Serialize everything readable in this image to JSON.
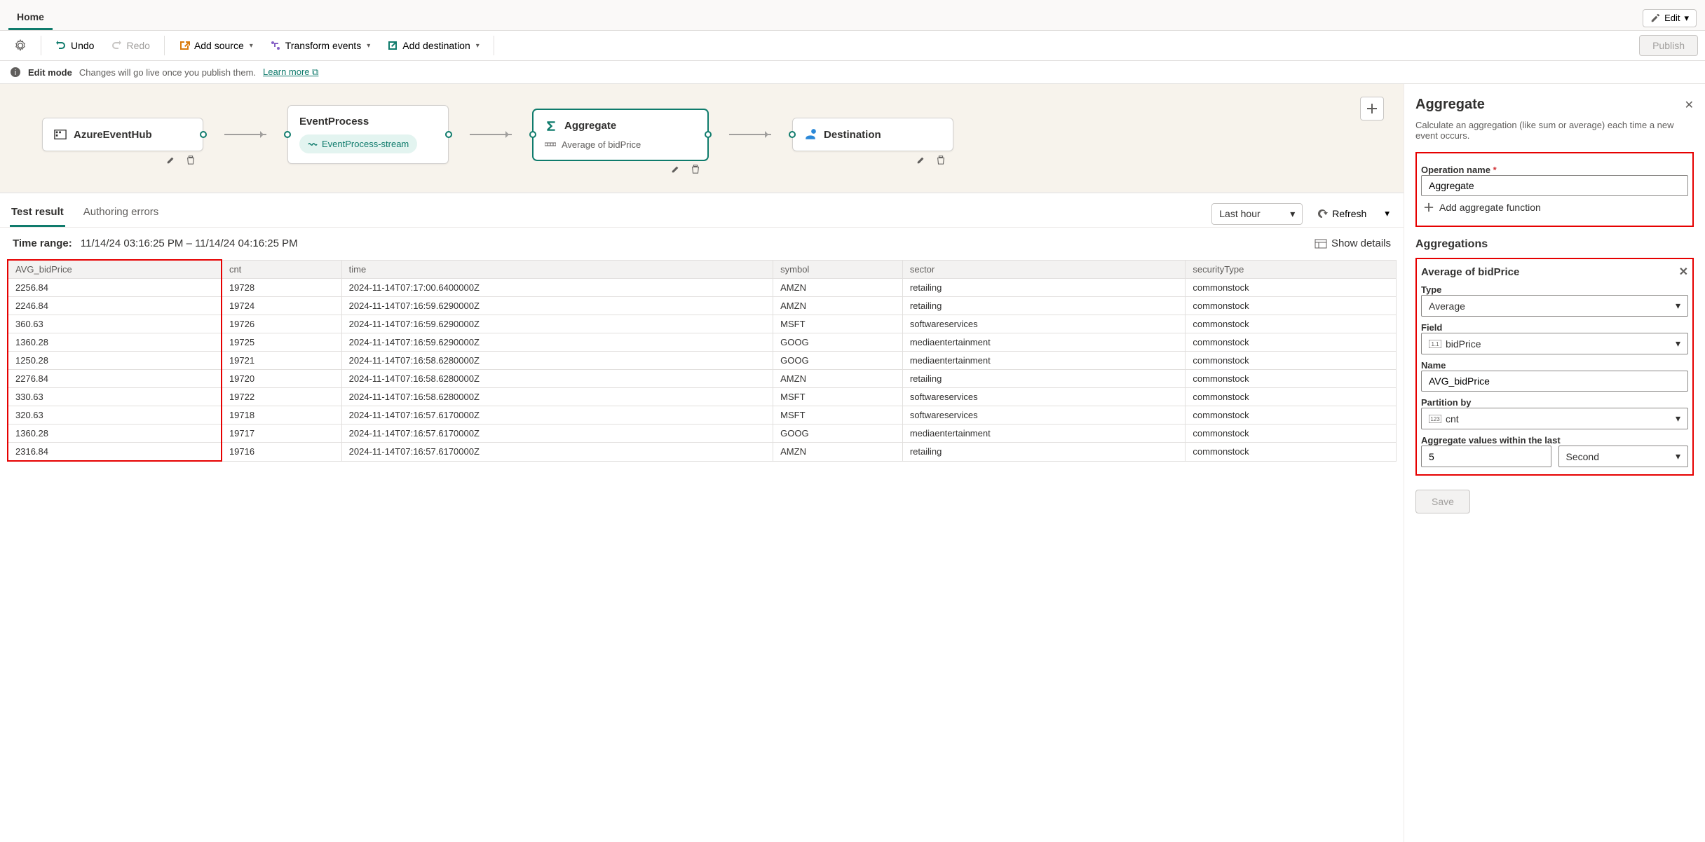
{
  "tabs": {
    "home": "Home",
    "edit": "Edit"
  },
  "toolbar": {
    "undo": "Undo",
    "redo": "Redo",
    "add_source": "Add source",
    "transform": "Transform events",
    "add_dest": "Add destination",
    "publish": "Publish"
  },
  "info": {
    "mode": "Edit mode",
    "msg": "Changes will go live once you publish them.",
    "learn": "Learn more"
  },
  "nodes": {
    "source": {
      "title": "AzureEventHub"
    },
    "process": {
      "title": "EventProcess",
      "stream": "EventProcess-stream"
    },
    "aggregate": {
      "title": "Aggregate",
      "sub": "Average of bidPrice"
    },
    "dest": {
      "title": "Destination"
    }
  },
  "results": {
    "tab_test": "Test result",
    "tab_errors": "Authoring errors",
    "range": "Last hour",
    "refresh": "Refresh",
    "time_label": "Time range:",
    "time_value": "11/14/24 03:16:25 PM – 11/14/24 04:16:25 PM",
    "show_details": "Show details",
    "columns": [
      "AVG_bidPrice",
      "cnt",
      "time",
      "symbol",
      "sector",
      "securityType"
    ],
    "rows": [
      [
        "2256.84",
        "19728",
        "2024-11-14T07:17:00.6400000Z",
        "AMZN",
        "retailing",
        "commonstock"
      ],
      [
        "2246.84",
        "19724",
        "2024-11-14T07:16:59.6290000Z",
        "AMZN",
        "retailing",
        "commonstock"
      ],
      [
        "360.63",
        "19726",
        "2024-11-14T07:16:59.6290000Z",
        "MSFT",
        "softwareservices",
        "commonstock"
      ],
      [
        "1360.28",
        "19725",
        "2024-11-14T07:16:59.6290000Z",
        "GOOG",
        "mediaentertainment",
        "commonstock"
      ],
      [
        "1250.28",
        "19721",
        "2024-11-14T07:16:58.6280000Z",
        "GOOG",
        "mediaentertainment",
        "commonstock"
      ],
      [
        "2276.84",
        "19720",
        "2024-11-14T07:16:58.6280000Z",
        "AMZN",
        "retailing",
        "commonstock"
      ],
      [
        "330.63",
        "19722",
        "2024-11-14T07:16:58.6280000Z",
        "MSFT",
        "softwareservices",
        "commonstock"
      ],
      [
        "320.63",
        "19718",
        "2024-11-14T07:16:57.6170000Z",
        "MSFT",
        "softwareservices",
        "commonstock"
      ],
      [
        "1360.28",
        "19717",
        "2024-11-14T07:16:57.6170000Z",
        "GOOG",
        "mediaentertainment",
        "commonstock"
      ],
      [
        "2316.84",
        "19716",
        "2024-11-14T07:16:57.6170000Z",
        "AMZN",
        "retailing",
        "commonstock"
      ]
    ]
  },
  "panel": {
    "title": "Aggregate",
    "desc": "Calculate an aggregation (like sum or average) each time a new event occurs.",
    "op_label": "Operation name",
    "op_value": "Aggregate",
    "add_fn": "Add aggregate function",
    "aggs_title": "Aggregations",
    "agg_item_title": "Average of bidPrice",
    "type_label": "Type",
    "type_value": "Average",
    "field_label": "Field",
    "field_value": "bidPrice",
    "name_label": "Name",
    "name_value": "AVG_bidPrice",
    "partition_label": "Partition by",
    "partition_value": "cnt",
    "window_label": "Aggregate values within the last",
    "window_num": "5",
    "window_unit": "Second",
    "save": "Save"
  }
}
